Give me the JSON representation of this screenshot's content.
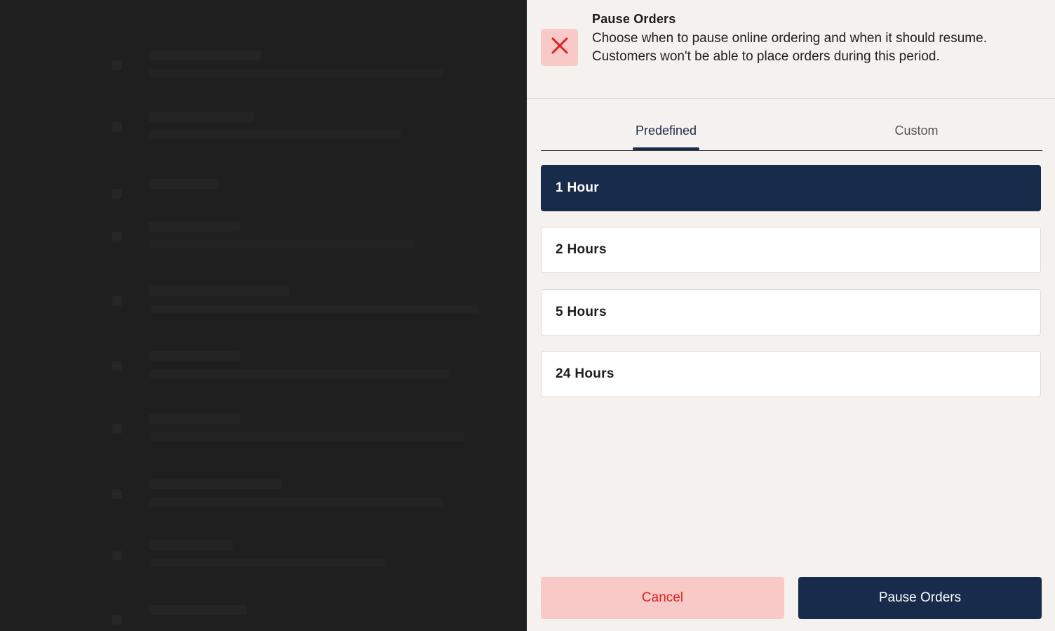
{
  "dialog": {
    "title": "Pause Orders",
    "description": "Choose when to pause online ordering and when it should resume. Customers won't be able to place orders during this period."
  },
  "tabs": [
    {
      "label": "Predefined",
      "active": true
    },
    {
      "label": "Custom",
      "active": false
    }
  ],
  "options": [
    {
      "label": "1 Hour",
      "selected": true
    },
    {
      "label": "2 Hours",
      "selected": false
    },
    {
      "label": "5 Hours",
      "selected": false
    },
    {
      "label": "24 Hours",
      "selected": false
    }
  ],
  "actions": {
    "cancel_label": "Cancel",
    "confirm_label": "Pause Orders"
  },
  "colors": {
    "accent": "#182b4b",
    "danger": "#e32020",
    "danger_bg": "#f8c9c7"
  },
  "icons": {
    "close": "close-icon"
  }
}
